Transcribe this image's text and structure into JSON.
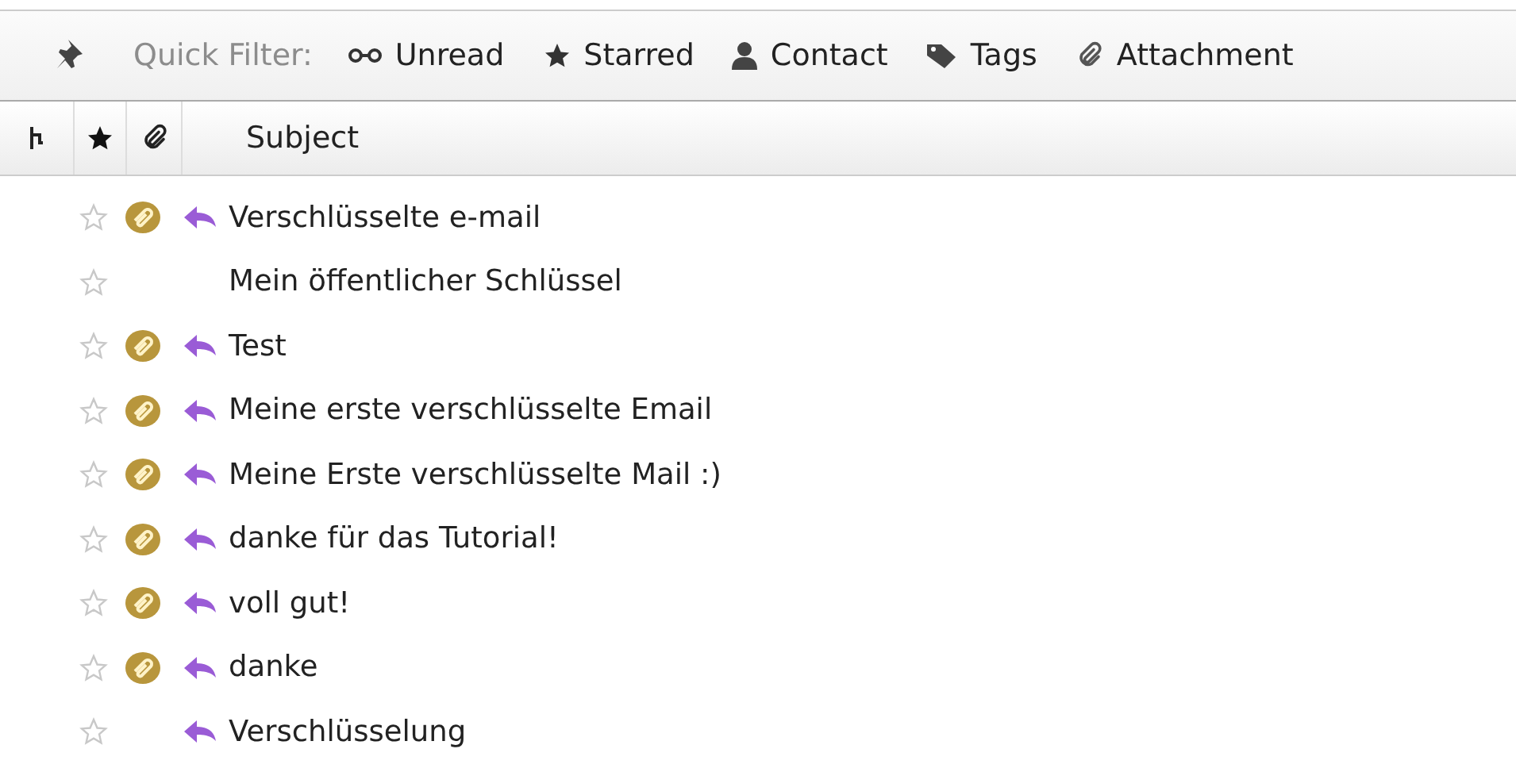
{
  "quick_filter": {
    "label": "Quick Filter:",
    "filters": [
      {
        "kind": "unread",
        "label": "Unread"
      },
      {
        "kind": "starred",
        "label": "Starred"
      },
      {
        "kind": "contact",
        "label": "Contact"
      },
      {
        "kind": "tags",
        "label": "Tags"
      },
      {
        "kind": "attachment",
        "label": "Attachment"
      }
    ]
  },
  "columns": {
    "subject": "Subject"
  },
  "messages": [
    {
      "subject": "Verschlüsselte e-mail",
      "starred": false,
      "attachment": true,
      "replied": true
    },
    {
      "subject": "Mein öffentlicher Schlüssel",
      "starred": false,
      "attachment": false,
      "replied": false
    },
    {
      "subject": "Test",
      "starred": false,
      "attachment": true,
      "replied": true
    },
    {
      "subject": "Meine erste verschlüsselte Email",
      "starred": false,
      "attachment": true,
      "replied": true
    },
    {
      "subject": "Meine Erste verschlüsselte Mail :)",
      "starred": false,
      "attachment": true,
      "replied": true
    },
    {
      "subject": "danke für das Tutorial!",
      "starred": false,
      "attachment": true,
      "replied": true
    },
    {
      "subject": "voll gut!",
      "starred": false,
      "attachment": true,
      "replied": true
    },
    {
      "subject": "danke",
      "starred": false,
      "attachment": true,
      "replied": true
    },
    {
      "subject": "Verschlüsselung",
      "starred": false,
      "attachment": false,
      "replied": true
    }
  ]
}
